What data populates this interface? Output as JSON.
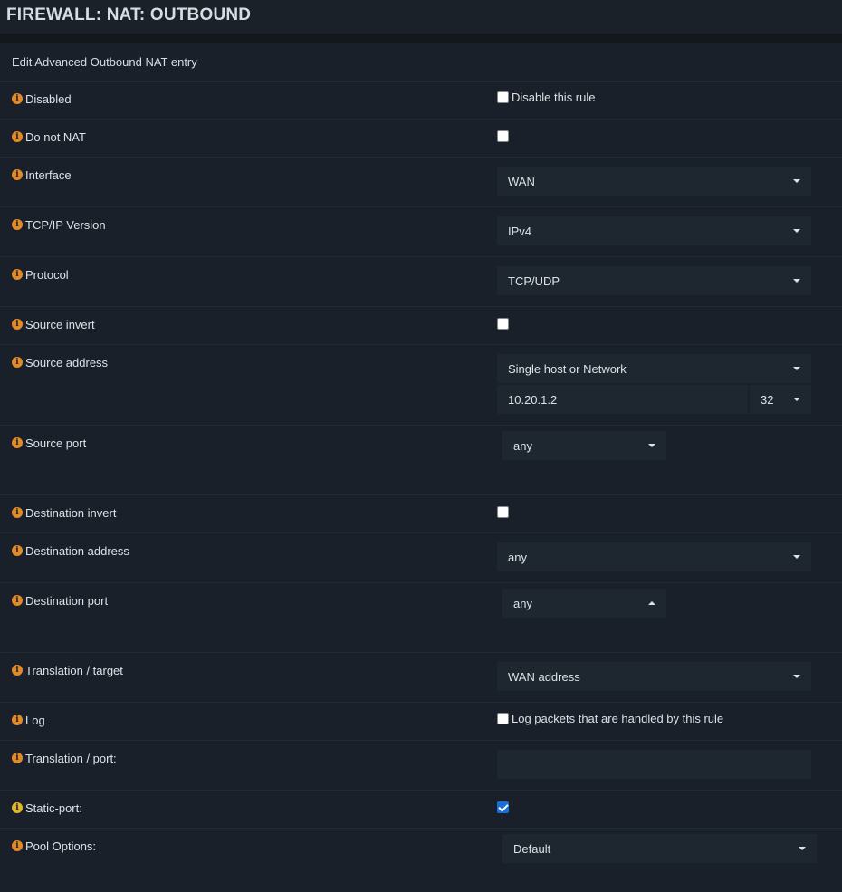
{
  "header": {
    "title": "FIREWALL: NAT: OUTBOUND"
  },
  "panel_title": "Edit Advanced Outbound NAT entry",
  "rows": {
    "disabled": {
      "label": "Disabled",
      "checkbox_label": "Disable this rule",
      "checked": false
    },
    "do_not_nat": {
      "label": "Do not NAT",
      "checked": false
    },
    "interface": {
      "label": "Interface",
      "value": "WAN"
    },
    "tcpip": {
      "label": "TCP/IP Version",
      "value": "IPv4"
    },
    "protocol": {
      "label": "Protocol",
      "value": "TCP/UDP"
    },
    "source_invert": {
      "label": "Source invert",
      "checked": false
    },
    "source_address": {
      "label": "Source address",
      "type": "Single host or Network",
      "address": "10.20.1.2",
      "mask": "32"
    },
    "source_port": {
      "label": "Source port",
      "value": "any"
    },
    "dest_invert": {
      "label": "Destination invert",
      "checked": false
    },
    "dest_address": {
      "label": "Destination address",
      "value": "any"
    },
    "dest_port": {
      "label": "Destination port",
      "value": "any"
    },
    "translation_target": {
      "label": "Translation / target",
      "value": "WAN address"
    },
    "log": {
      "label": "Log",
      "checkbox_label": "Log packets that are handled by this rule",
      "checked": false
    },
    "translation_port": {
      "label": "Translation / port:",
      "value": ""
    },
    "static_port": {
      "label": "Static-port:",
      "checked": true
    },
    "pool_options": {
      "label": "Pool Options:",
      "value": "Default"
    }
  },
  "colors": {
    "info_icon": "#e08a2a",
    "info_icon_hover": "#e0b72a",
    "checkbox_checked": "#1a6ed8"
  }
}
